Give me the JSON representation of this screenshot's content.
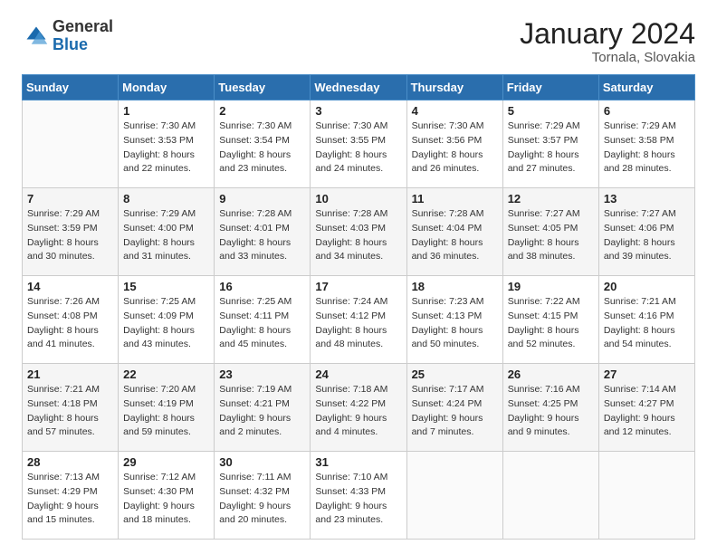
{
  "logo": {
    "general": "General",
    "blue": "Blue"
  },
  "header": {
    "month": "January 2024",
    "location": "Tornala, Slovakia"
  },
  "weekdays": [
    "Sunday",
    "Monday",
    "Tuesday",
    "Wednesday",
    "Thursday",
    "Friday",
    "Saturday"
  ],
  "weeks": [
    [
      {
        "day": null
      },
      {
        "day": 1,
        "sunrise": "7:30 AM",
        "sunset": "3:53 PM",
        "daylight": "8 hours and 22 minutes."
      },
      {
        "day": 2,
        "sunrise": "7:30 AM",
        "sunset": "3:54 PM",
        "daylight": "8 hours and 23 minutes."
      },
      {
        "day": 3,
        "sunrise": "7:30 AM",
        "sunset": "3:55 PM",
        "daylight": "8 hours and 24 minutes."
      },
      {
        "day": 4,
        "sunrise": "7:30 AM",
        "sunset": "3:56 PM",
        "daylight": "8 hours and 26 minutes."
      },
      {
        "day": 5,
        "sunrise": "7:29 AM",
        "sunset": "3:57 PM",
        "daylight": "8 hours and 27 minutes."
      },
      {
        "day": 6,
        "sunrise": "7:29 AM",
        "sunset": "3:58 PM",
        "daylight": "8 hours and 28 minutes."
      }
    ],
    [
      {
        "day": 7,
        "sunrise": "7:29 AM",
        "sunset": "3:59 PM",
        "daylight": "8 hours and 30 minutes."
      },
      {
        "day": 8,
        "sunrise": "7:29 AM",
        "sunset": "4:00 PM",
        "daylight": "8 hours and 31 minutes."
      },
      {
        "day": 9,
        "sunrise": "7:28 AM",
        "sunset": "4:01 PM",
        "daylight": "8 hours and 33 minutes."
      },
      {
        "day": 10,
        "sunrise": "7:28 AM",
        "sunset": "4:03 PM",
        "daylight": "8 hours and 34 minutes."
      },
      {
        "day": 11,
        "sunrise": "7:28 AM",
        "sunset": "4:04 PM",
        "daylight": "8 hours and 36 minutes."
      },
      {
        "day": 12,
        "sunrise": "7:27 AM",
        "sunset": "4:05 PM",
        "daylight": "8 hours and 38 minutes."
      },
      {
        "day": 13,
        "sunrise": "7:27 AM",
        "sunset": "4:06 PM",
        "daylight": "8 hours and 39 minutes."
      }
    ],
    [
      {
        "day": 14,
        "sunrise": "7:26 AM",
        "sunset": "4:08 PM",
        "daylight": "8 hours and 41 minutes."
      },
      {
        "day": 15,
        "sunrise": "7:25 AM",
        "sunset": "4:09 PM",
        "daylight": "8 hours and 43 minutes."
      },
      {
        "day": 16,
        "sunrise": "7:25 AM",
        "sunset": "4:11 PM",
        "daylight": "8 hours and 45 minutes."
      },
      {
        "day": 17,
        "sunrise": "7:24 AM",
        "sunset": "4:12 PM",
        "daylight": "8 hours and 48 minutes."
      },
      {
        "day": 18,
        "sunrise": "7:23 AM",
        "sunset": "4:13 PM",
        "daylight": "8 hours and 50 minutes."
      },
      {
        "day": 19,
        "sunrise": "7:22 AM",
        "sunset": "4:15 PM",
        "daylight": "8 hours and 52 minutes."
      },
      {
        "day": 20,
        "sunrise": "7:21 AM",
        "sunset": "4:16 PM",
        "daylight": "8 hours and 54 minutes."
      }
    ],
    [
      {
        "day": 21,
        "sunrise": "7:21 AM",
        "sunset": "4:18 PM",
        "daylight": "8 hours and 57 minutes."
      },
      {
        "day": 22,
        "sunrise": "7:20 AM",
        "sunset": "4:19 PM",
        "daylight": "8 hours and 59 minutes."
      },
      {
        "day": 23,
        "sunrise": "7:19 AM",
        "sunset": "4:21 PM",
        "daylight": "9 hours and 2 minutes."
      },
      {
        "day": 24,
        "sunrise": "7:18 AM",
        "sunset": "4:22 PM",
        "daylight": "9 hours and 4 minutes."
      },
      {
        "day": 25,
        "sunrise": "7:17 AM",
        "sunset": "4:24 PM",
        "daylight": "9 hours and 7 minutes."
      },
      {
        "day": 26,
        "sunrise": "7:16 AM",
        "sunset": "4:25 PM",
        "daylight": "9 hours and 9 minutes."
      },
      {
        "day": 27,
        "sunrise": "7:14 AM",
        "sunset": "4:27 PM",
        "daylight": "9 hours and 12 minutes."
      }
    ],
    [
      {
        "day": 28,
        "sunrise": "7:13 AM",
        "sunset": "4:29 PM",
        "daylight": "9 hours and 15 minutes."
      },
      {
        "day": 29,
        "sunrise": "7:12 AM",
        "sunset": "4:30 PM",
        "daylight": "9 hours and 18 minutes."
      },
      {
        "day": 30,
        "sunrise": "7:11 AM",
        "sunset": "4:32 PM",
        "daylight": "9 hours and 20 minutes."
      },
      {
        "day": 31,
        "sunrise": "7:10 AM",
        "sunset": "4:33 PM",
        "daylight": "9 hours and 23 minutes."
      },
      {
        "day": null
      },
      {
        "day": null
      },
      {
        "day": null
      }
    ]
  ]
}
